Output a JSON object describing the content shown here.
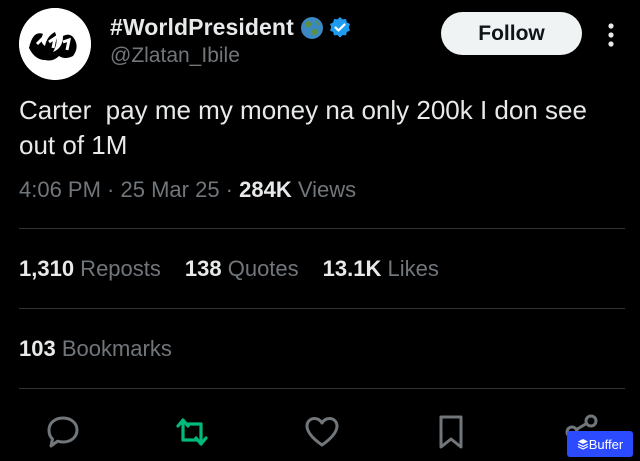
{
  "author": {
    "display_name": "#WorldPresident",
    "handle": "@Zlatan_Ibile",
    "avatar_icon": "zlatan-logo-avatar",
    "badges": [
      "globe-emoji",
      "verified-badge"
    ]
  },
  "follow_label": "Follow",
  "tweet": {
    "text": "Carter  pay me my money na only 200k I don see out of 1M"
  },
  "meta": {
    "time": "4:06 PM",
    "sep1": " · ",
    "date": "25 Mar 25",
    "sep2": " · ",
    "views_count": "284K",
    "views_label": " Views"
  },
  "stats": {
    "reposts_count": "1,310",
    "reposts_label": " Reposts",
    "quotes_count": "138",
    "quotes_label": " Quotes",
    "likes_count": "13.1K",
    "likes_label": " Likes",
    "bookmarks_count": "103",
    "bookmarks_label": " Bookmarks"
  },
  "actions": [
    "reply-icon",
    "repost-icon",
    "like-icon",
    "bookmark-icon",
    "share-icon"
  ],
  "buffer": {
    "label": "Buffer"
  },
  "colors": {
    "background": "#000000",
    "text": "#e7e9ea",
    "muted": "#71767b",
    "divider": "#2f3336",
    "repost_green": "#00ba7c",
    "verified_blue": "#1d9bf0",
    "buffer_blue": "#2c4bff"
  }
}
